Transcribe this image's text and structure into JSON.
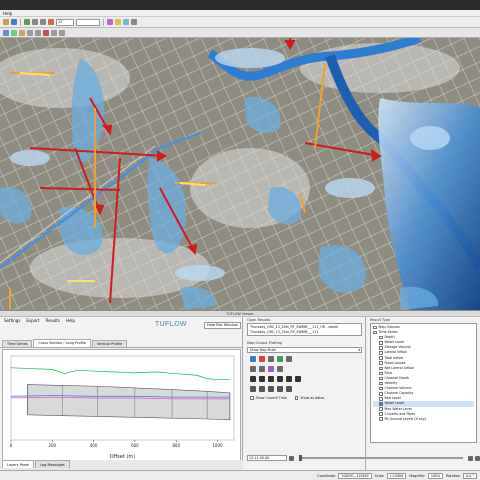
{
  "window": {
    "title": "",
    "menu": "Help"
  },
  "toolbar": {
    "zoom_field": "12",
    "scale_field": ""
  },
  "map": {
    "description_icon": "flood-depth-map"
  },
  "dock": {
    "title": "TUFLOW Viewer"
  },
  "left_panel": {
    "menu": [
      "Settings",
      "Export",
      "Results",
      "Help"
    ],
    "logo": "TUFLOW",
    "help_toggle": "Hide Plot Window",
    "tabs": [
      "Time Series",
      "Cross Section / Long Profile",
      "Vertical Profile"
    ],
    "active_tab": 1,
    "bottom_tabs": [
      "Layers Panel",
      "Log Messages"
    ]
  },
  "chart_data": {
    "type": "line",
    "xlabel": "Offset (m)",
    "x_ticks": [
      0,
      200,
      400,
      600,
      800,
      1000
    ],
    "xlim": [
      0,
      1080
    ],
    "series": [
      {
        "name": "",
        "color": "#22c55e",
        "x": [
          0,
          100,
          200,
          260,
          320,
          400,
          500,
          600,
          700,
          800,
          900,
          950,
          1000,
          1060
        ],
        "y": [
          0.86,
          0.85,
          0.84,
          0.79,
          0.83,
          0.82,
          0.81,
          0.8,
          0.81,
          0.79,
          0.77,
          0.73,
          0.72,
          0.72
        ]
      },
      {
        "name": "",
        "color": "#e85aa8",
        "x": [
          0,
          200,
          400,
          600,
          800,
          1000,
          1060
        ],
        "y": [
          0.5,
          0.51,
          0.5,
          0.5,
          0.49,
          0.49,
          0.49
        ]
      },
      {
        "name": "",
        "color": "#3b82f6",
        "x": [
          0,
          200,
          400,
          600,
          800,
          1000,
          1060
        ],
        "y": [
          0.52,
          0.53,
          0.52,
          0.52,
          0.51,
          0.51,
          0.51
        ]
      }
    ],
    "culvert_top": [
      0.66,
      0.65,
      0.64,
      0.62,
      0.6,
      0.58,
      0.56
    ],
    "culvert_bottom": [
      0.3,
      0.29,
      0.28,
      0.27,
      0.26,
      0.25,
      0.24
    ],
    "culvert_x": [
      80,
      250,
      420,
      600,
      780,
      950,
      1060
    ]
  },
  "mid_panel": {
    "open_results_title": "Open Results",
    "results": [
      "Thursday_QRC_13_20m_RF_SWMM___111_HR - depth",
      "Thursday_QRC_13_20m_RF_SWMM___111"
    ],
    "map_output_title": "Map Output Plotting",
    "map_output_dropdown": "Draw Map Multi",
    "checkbox_current_time": "Show Current Time",
    "checkbox_show_as_dates": "Show as dates",
    "time_value": "12:11:30.00"
  },
  "right_panel": {
    "title": "Result Type",
    "tree": [
      {
        "label": "Map Outputs",
        "level": 1,
        "selected": false
      },
      {
        "label": "Time Series",
        "level": 1,
        "selected": false
      },
      {
        "label": "Depth",
        "level": 2,
        "selected": false
      },
      {
        "label": "Water Level",
        "level": 2,
        "selected": false
      },
      {
        "label": "Storage Volume",
        "level": 2,
        "selected": false
      },
      {
        "label": "Lateral Inflow",
        "level": 2,
        "selected": false
      },
      {
        "label": "Total Inflow",
        "level": 2,
        "selected": false
      },
      {
        "label": "Flood Losses",
        "level": 2,
        "selected": false
      },
      {
        "label": "Net Lateral Inflow",
        "level": 2,
        "selected": false
      },
      {
        "label": "Flow",
        "level": 2,
        "selected": false
      },
      {
        "label": "Channel Depth",
        "level": 2,
        "selected": false
      },
      {
        "label": "Velocity",
        "level": 2,
        "selected": false
      },
      {
        "label": "Channel Volume",
        "level": 2,
        "selected": false
      },
      {
        "label": "Channel Capacity",
        "level": 2,
        "selected": false
      },
      {
        "label": "Bed Level",
        "level": 2,
        "selected": false
      },
      {
        "label": "Water Level",
        "level": 2,
        "selected": true
      },
      {
        "label": "Max Water Level",
        "level": 2,
        "selected": false
      },
      {
        "label": "Culverts and Pipes",
        "level": 2,
        "selected": false
      },
      {
        "label": "Pit Ground Levels (if any)",
        "level": 2,
        "selected": false
      }
    ]
  },
  "statusbar": {
    "coordinate_label": "Coordinate",
    "coordinate": "306391,-115893",
    "scale_label": "Scale",
    "scale": "1:13906",
    "magnifier_label": "Magnifier",
    "magnifier": "100%",
    "rotation_label": "Rotation",
    "rotation": "0.0 °"
  }
}
